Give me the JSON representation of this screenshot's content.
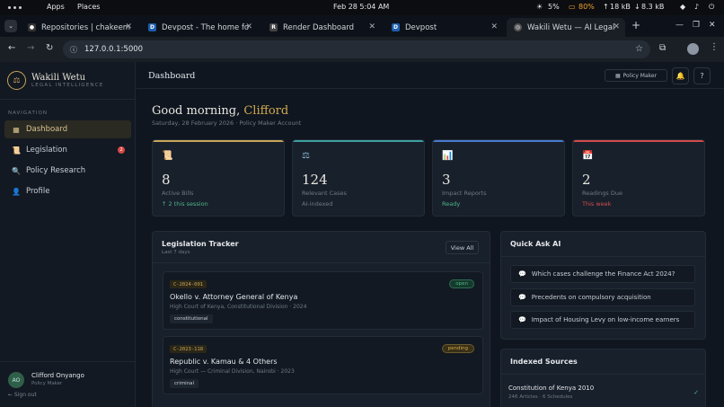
{
  "system_bar": {
    "apps": "Apps",
    "places": "Places",
    "datetime": "Feb 28  5:04 AM",
    "brightness": "5%",
    "battery": "80%",
    "net_up": "18 kB",
    "net_down": "8.3 kB"
  },
  "browser": {
    "tabs": [
      {
        "title": "Repositories | chakeem"
      },
      {
        "title": "Devpost - The home fo"
      },
      {
        "title": "Render Dashboard"
      },
      {
        "title": "Devpost"
      },
      {
        "title": "Wakili Wetu — AI Legal"
      }
    ],
    "url": "127.0.0.1:5000"
  },
  "sidebar": {
    "brand_name": "Wakili Wetu",
    "brand_sub": "LEGAL INTELLIGENCE",
    "nav_label": "NAVIGATION",
    "items": [
      {
        "label": "Dashboard"
      },
      {
        "label": "Legislation",
        "badge": "2"
      },
      {
        "label": "Policy Research"
      },
      {
        "label": "Profile"
      }
    ],
    "user": {
      "initials": "AO",
      "name": "Clifford Onyango",
      "role": "Policy Maker",
      "sign_out": "← Sign out"
    }
  },
  "header": {
    "title": "Dashboard",
    "policy_maker": "Policy Maker",
    "help": "?"
  },
  "greeting": {
    "prefix": "Good morning, ",
    "name": "Clifford",
    "date": "Saturday, 28 February 2026 · Policy Maker Account"
  },
  "stats": [
    {
      "value": "8",
      "label": "Active Bills",
      "sub": "↑ 2 this session",
      "color": "#c9a55a"
    },
    {
      "value": "124",
      "label": "Relevant Cases",
      "sub": "AI-indexed",
      "color": "#3f9fa0"
    },
    {
      "value": "3",
      "label": "Impact Reports",
      "sub": "Ready",
      "color": "#4a7bd0"
    },
    {
      "value": "2",
      "label": "Readings Due",
      "sub": "This week",
      "color": "#d24b4b"
    }
  ],
  "tracker": {
    "title": "Legislation Tracker",
    "subtitle": "Last 7 days",
    "view_all": "View All",
    "cases": [
      {
        "id": "C-2024-001",
        "title": "Okello v. Attorney General of Kenya",
        "court": "High Court of Kenya, Constitutional Division · 2024",
        "tag": "constitutional",
        "status": "open"
      },
      {
        "id": "C-2023-118",
        "title": "Republic v. Kamau & 4 Others",
        "court": "High Court — Criminal Division, Nairobi · 2023",
        "tag": "criminal",
        "status": "pending"
      }
    ]
  },
  "quick_ask": {
    "title": "Quick Ask AI",
    "questions": [
      "Which cases challenge the Finance Act 2024?",
      "Precedents on compulsory acquisition",
      "Impact of Housing Levy on low-income earners"
    ]
  },
  "sources": {
    "title": "Indexed Sources",
    "items": [
      {
        "title": "Constitution of Kenya 2010",
        "sub": "246 Articles · 6 Schedules"
      }
    ]
  }
}
